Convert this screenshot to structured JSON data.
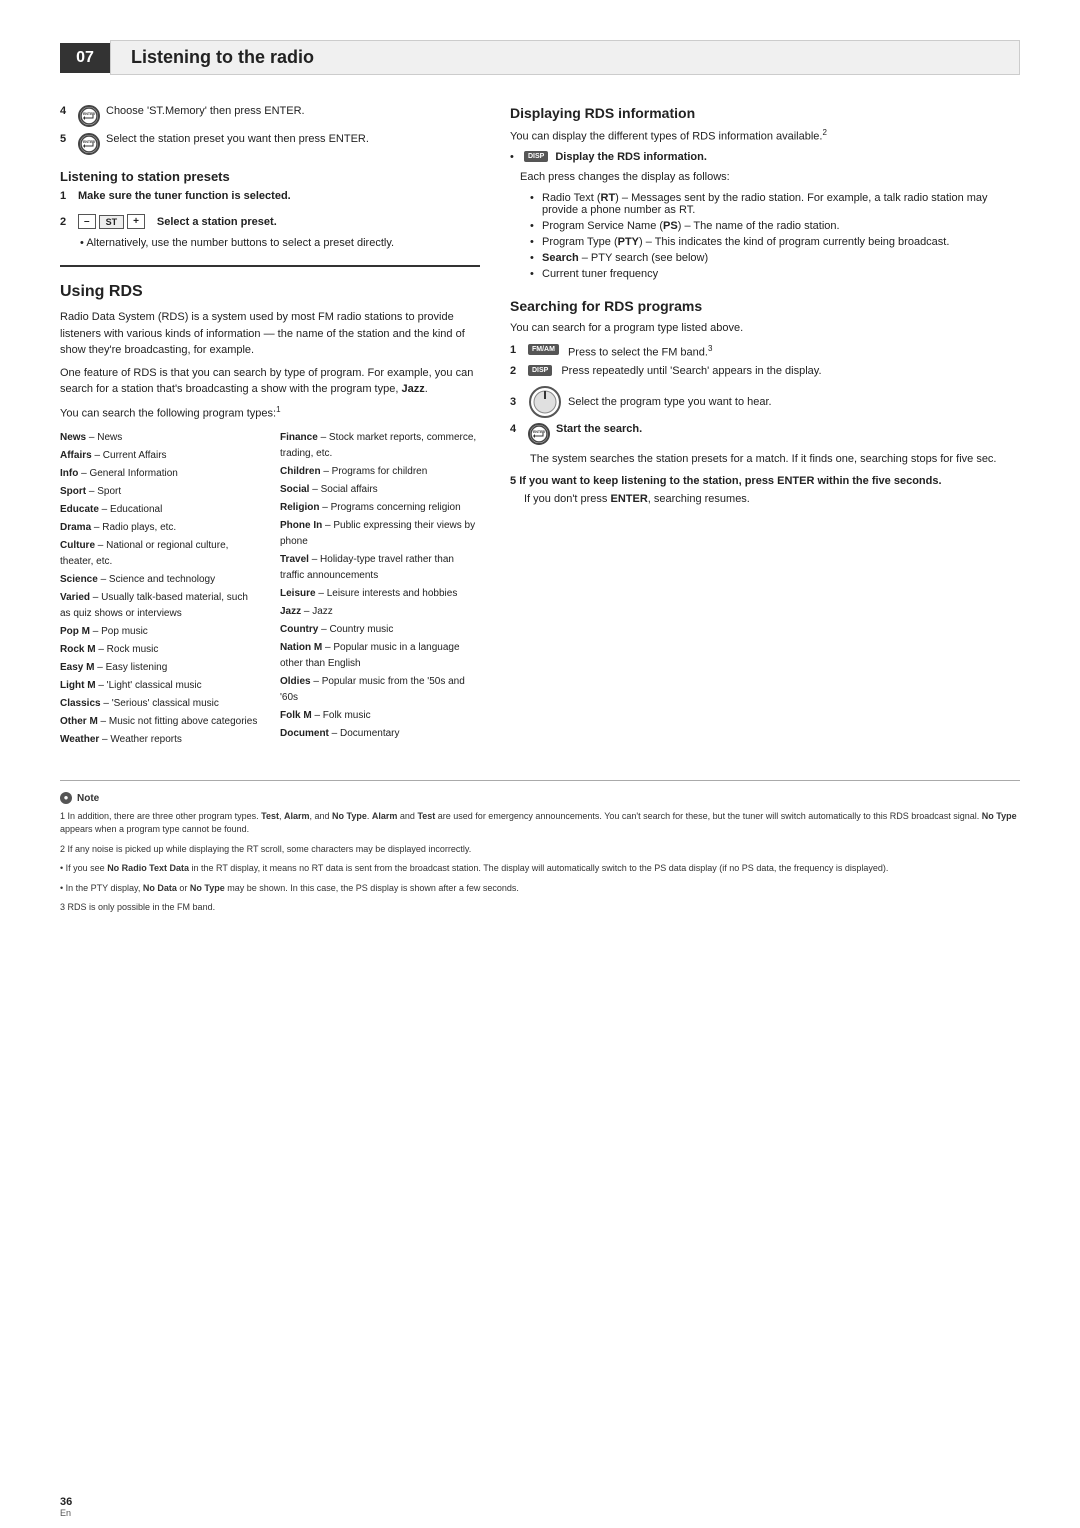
{
  "chapter": {
    "number": "07",
    "title": "Listening to the radio"
  },
  "left_column": {
    "step4": {
      "icon": "ENTER",
      "text": "Choose 'ST.Memory' then press ENTER."
    },
    "step5": {
      "icon": "ENTER",
      "text": "Select the station preset you want then press ENTER."
    },
    "presets_section": {
      "heading": "Listening to station presets",
      "step1": "Make sure the tuner function is selected.",
      "step2_label": "Select a station preset.",
      "step2_note": "Alternatively, use the number buttons to select a preset directly."
    },
    "using_rds": {
      "heading": "Using RDS",
      "para1": "Radio Data System (RDS) is a system used by most FM radio stations to provide listeners with various kinds of information — the name of the station and the kind of show they're broadcasting, for example.",
      "para2": "One feature of RDS is that you can search by type of program. For example, you can search for a station that's broadcasting a show with the program type, Jazz.",
      "para3": "You can search the following program types:",
      "program_types_left": [
        {
          "name": "News",
          "desc": "News"
        },
        {
          "name": "Affairs",
          "desc": "Current Affairs"
        },
        {
          "name": "Info",
          "desc": "General Information"
        },
        {
          "name": "Sport",
          "desc": "Sport"
        },
        {
          "name": "Educate",
          "desc": "Educational"
        },
        {
          "name": "Drama",
          "desc": "Radio plays, etc."
        },
        {
          "name": "Culture",
          "desc": "National or regional culture, theater, etc."
        },
        {
          "name": "Science",
          "desc": "Science and technology"
        },
        {
          "name": "Varied",
          "desc": "Usually talk-based material, such as quiz shows or interviews"
        },
        {
          "name": "Pop M",
          "desc": "Pop music"
        },
        {
          "name": "Rock M",
          "desc": "Rock music"
        },
        {
          "name": "Easy M",
          "desc": "Easy listening"
        },
        {
          "name": "Light M",
          "desc": "'Light' classical music"
        },
        {
          "name": "Classics",
          "desc": "'Serious' classical music"
        },
        {
          "name": "Other M",
          "desc": "Music not fitting above categories"
        },
        {
          "name": "Weather",
          "desc": "Weather reports"
        }
      ],
      "program_types_right": [
        {
          "name": "Finance",
          "desc": "Stock market reports, commerce, trading, etc."
        },
        {
          "name": "Children",
          "desc": "Programs for children"
        },
        {
          "name": "Social",
          "desc": "Social affairs"
        },
        {
          "name": "Religion",
          "desc": "Programs concerning religion"
        },
        {
          "name": "Phone In",
          "desc": "Public expressing their views by phone"
        },
        {
          "name": "Travel",
          "desc": "Holiday-type travel rather than traffic announcements"
        },
        {
          "name": "Leisure",
          "desc": "Leisure interests and hobbies"
        },
        {
          "name": "Jazz",
          "desc": "Jazz"
        },
        {
          "name": "Country",
          "desc": "Country music"
        },
        {
          "name": "Nation M",
          "desc": "Popular music in a language other than English"
        },
        {
          "name": "Oldies",
          "desc": "Popular music from the '50s and '60s"
        },
        {
          "name": "Folk M",
          "desc": "Folk music"
        },
        {
          "name": "Document",
          "desc": "Documentary"
        }
      ]
    }
  },
  "right_column": {
    "displaying_rds": {
      "heading": "Displaying RDS information",
      "intro": "You can display the different types of RDS information available.",
      "footnote": "2",
      "step_disp": "Display the RDS information.",
      "step_disp_sub": "Each press changes the display as follows:",
      "bullets": [
        {
          "key": "Radio Text (RT)",
          "bold_part": "RT",
          "desc": "Messages sent by the radio station. For example, a talk radio station may provide a phone number as RT."
        },
        {
          "key": "Program Service Name (PS)",
          "bold_part": "PS",
          "desc": "The name of the radio station."
        },
        {
          "key": "Program Type (PTY)",
          "bold_part": "PTY",
          "desc": "This indicates the kind of program currently being broadcast."
        },
        {
          "key": "Search",
          "desc": "PTY search (see below)"
        },
        {
          "key": "Current tuner frequency",
          "desc": ""
        }
      ]
    },
    "searching_rds": {
      "heading": "Searching for RDS programs",
      "intro": "You can search for a program type listed above.",
      "step1_icon": "FMAM",
      "step1_text": "Press to select the FM band.",
      "step1_footnote": "3",
      "step2_icon": "DISP",
      "step2_text": "Press repeatedly until 'Search' appears in the display.",
      "step3_text": "Select the program type you want to hear.",
      "step4_icon": "ENTER",
      "step4_text": "Start the search.",
      "step4_sub": "The system searches the station presets for a match. If it finds one, searching stops for five sec.",
      "step5_text": "If you want to keep listening to the station, press ENTER within the five seconds.",
      "step5_sub": "If you don't press ENTER, searching resumes."
    }
  },
  "notes": {
    "label": "Note",
    "items": [
      "1 In addition, there are three other program types. Test, Alarm, and No Type. Alarm and Test are used for emergency announcements. You can't search for these, but the tuner will switch automatically to this RDS broadcast signal. No Type appears when a program type cannot be found.",
      "2 If any noise is picked up while displaying the RT scroll, some characters may be displayed incorrectly.",
      "• If you see No Radio Text Data in the RT display, it means no RT data is sent from the broadcast station. The display will automatically switch to the PS data display (if no PS data, the frequency is displayed).",
      "• In the PTY display, No Data or No Type may be shown. In this case, the PS display is shown after a few seconds.",
      "3 RDS is only possible in the FM band."
    ]
  },
  "page_number": "36",
  "page_lang": "En"
}
